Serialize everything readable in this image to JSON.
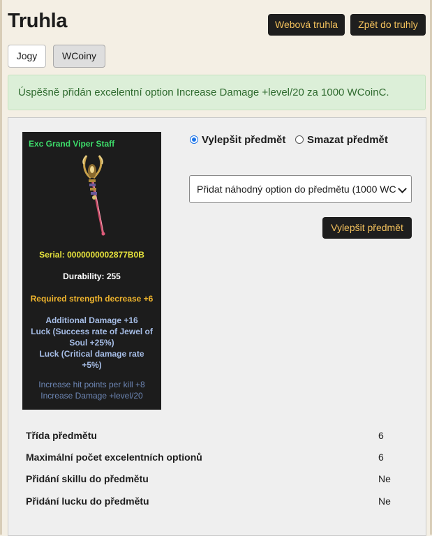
{
  "page": {
    "title": "Truhla"
  },
  "header_buttons": {
    "web_chest": "Webová truhla",
    "back_to_chest": "Zpět do truhly"
  },
  "tabs": [
    {
      "label": "Jogy",
      "active": false
    },
    {
      "label": "WCoiny",
      "active": true
    }
  ],
  "alert": {
    "message": "Úspěšně přidán excelentní option Increase Damage +level/20 za 1000 WCoinC."
  },
  "item": {
    "name": "Exc Grand Viper Staff",
    "icon": "staff-icon",
    "serial": "Serial: 0000000002877B0B",
    "durability": "Durability: 255",
    "requirement": "Required strength decrease +6",
    "options": [
      "Additional Damage +16",
      "Luck (Success rate of Jewel of",
      "Soul +25%)",
      "Luck (Critical damage rate",
      "+5%)"
    ],
    "excellent_options": [
      "Increase hit points per kill +8",
      "Increase Damage +level/20"
    ]
  },
  "actions": {
    "upgrade_radio": "Vylepšit předmět",
    "delete_radio": "Smazat předmět",
    "selected": "upgrade",
    "select_value": "Přidat náhodný option do předmětu (1000 WC",
    "upgrade_button": "Vylepšit předmět"
  },
  "info_rows": [
    {
      "label": "Třída předmětu",
      "value": "6"
    },
    {
      "label": "Maximální počet excelentních optionů",
      "value": "6"
    },
    {
      "label": "Přidání skillu do předmětu",
      "value": "Ne"
    },
    {
      "label": "Přidání lucku do předmětu",
      "value": "Ne"
    }
  ],
  "colors": {
    "accent_button_bg": "#1e1e1e",
    "accent_button_text": "#f2c05c",
    "alert_bg": "#dcefd8",
    "alert_text": "#2f6b2f",
    "item_name": "#3ddc6a",
    "serial": "#e6e23c",
    "requirement": "#f0b52d",
    "options": "#a6bde6",
    "excellent": "#6d86b4"
  }
}
